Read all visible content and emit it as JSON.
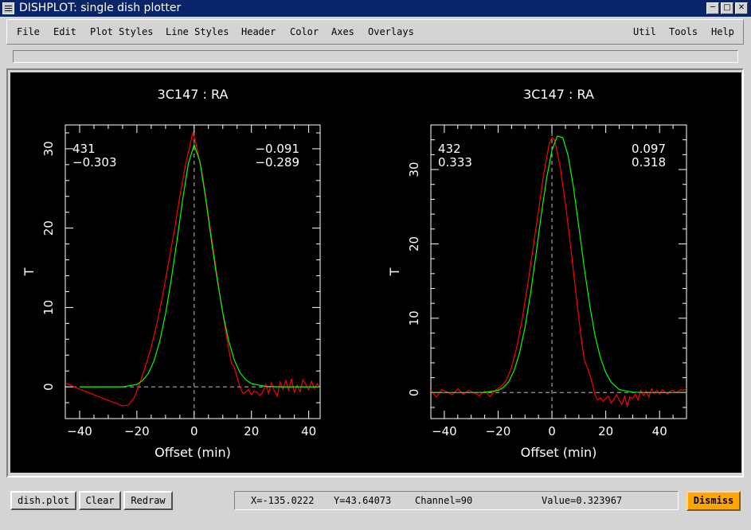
{
  "window": {
    "title": "DISHPLOT: single dish plotter"
  },
  "menu": {
    "left": [
      "File",
      "Edit",
      "Plot Styles",
      "Line Styles",
      "Header",
      "Color",
      "Axes",
      "Overlays"
    ],
    "right": [
      "Util",
      "Tools",
      "Help"
    ]
  },
  "bottom": {
    "buttons": [
      "dish.plot",
      "Clear",
      "Redraw"
    ],
    "status": {
      "x": "X=-135.0222",
      "y": "Y=43.64073",
      "channel": "Channel=90",
      "value": "Value=0.323967"
    },
    "dismiss": "Dismiss"
  },
  "colors": {
    "data": "#ff0000",
    "fit": "#00ff00",
    "axes": "#ffffff",
    "background": "#000000",
    "dismiss": "#ffa500"
  },
  "chart_data": [
    {
      "type": "line",
      "title": "3C147  :  RA",
      "xlabel": "Offset (min)",
      "ylabel": "T",
      "xlim": [
        -45,
        44
      ],
      "ylim": [
        -4,
        33
      ],
      "xticks": [
        -40,
        -20,
        0,
        20,
        40
      ],
      "yticks": [
        0,
        10,
        20,
        30
      ],
      "annotations": {
        "top_left": [
          "431",
          "−0.303"
        ],
        "top_right": [
          "−0.091",
          "−0.289"
        ]
      },
      "series": [
        {
          "color": "#ff0000",
          "x": [
            -45,
            -40,
            -35,
            -30,
            -27,
            -25,
            -23,
            -21,
            -19,
            -17,
            -15,
            -13,
            -11,
            -9,
            -7,
            -5,
            -3,
            -1,
            -0.5,
            0,
            0.5,
            1,
            3,
            5,
            7,
            9,
            11,
            13,
            14,
            15,
            16,
            17,
            18,
            19,
            20,
            21,
            22,
            23,
            24,
            25,
            26,
            27,
            28,
            29,
            30,
            31,
            32,
            33,
            34,
            35,
            36,
            37,
            38,
            39,
            40,
            41,
            42,
            43,
            44
          ],
          "y": [
            0.5,
            -0.3,
            -1.0,
            -1.7,
            -2.1,
            -2.4,
            -2.3,
            -1.4,
            0.4,
            2.6,
            5.0,
            8.0,
            11.5,
            15.5,
            19.5,
            24.0,
            28.0,
            31.2,
            32.0,
            31.5,
            30.8,
            30.0,
            26.5,
            21.5,
            16.5,
            11.5,
            7.0,
            3.0,
            2.5,
            1.2,
            0.0,
            -0.8,
            -0.7,
            -0.3,
            -1.0,
            -0.5,
            -0.7,
            -1.1,
            -0.6,
            0.3,
            -0.8,
            0.5,
            -0.5,
            -1.2,
            0.6,
            -0.3,
            0.8,
            -0.4,
            1.0,
            -0.7,
            0.2,
            -0.6,
            0.9,
            0.3,
            -0.4,
            0.7,
            -0.2,
            0.4,
            -0.1
          ]
        },
        {
          "color": "#00ff00",
          "x": [
            -40,
            -35,
            -30,
            -25,
            -20,
            -18,
            -16,
            -14,
            -12,
            -10,
            -8,
            -6,
            -4,
            -2,
            0,
            2,
            4,
            6,
            8,
            10,
            12,
            14,
            16,
            18,
            20,
            25,
            30,
            35,
            40,
            44
          ],
          "y": [
            0.0,
            0.0,
            0.0,
            0.0,
            0.3,
            0.8,
            1.7,
            3.3,
            5.8,
            9.2,
            13.5,
            18.4,
            23.6,
            28.2,
            30.5,
            28.4,
            23.8,
            18.5,
            13.6,
            9.3,
            5.9,
            3.4,
            1.8,
            0.9,
            0.4,
            0.05,
            0.0,
            0.0,
            0.0,
            0.0
          ]
        }
      ]
    },
    {
      "type": "line",
      "title": "3C147  :  RA",
      "xlabel": "Offset (min)",
      "ylabel": "T",
      "xlim": [
        -45,
        50
      ],
      "ylim": [
        -3.5,
        36
      ],
      "xticks": [
        -40,
        -20,
        0,
        20,
        40
      ],
      "yticks": [
        0,
        10,
        20,
        30
      ],
      "annotations": {
        "top_left": [
          "432",
          "0.333"
        ],
        "top_right": [
          "0.097",
          "0.318"
        ]
      },
      "series": [
        {
          "color": "#ff0000",
          "x": [
            -45,
            -43,
            -41,
            -39,
            -37,
            -35,
            -33,
            -31,
            -29,
            -27,
            -25,
            -23,
            -21,
            -19,
            -17,
            -15,
            -13,
            -11,
            -9,
            -7,
            -5,
            -3,
            -1,
            0,
            1,
            3,
            5,
            7,
            9,
            11,
            12,
            13,
            14,
            15,
            16,
            17,
            18,
            19,
            20,
            21,
            22,
            23,
            24,
            25,
            26,
            27,
            28,
            29,
            30,
            31,
            32,
            33,
            34,
            35,
            36,
            37,
            38,
            39,
            40,
            41,
            42,
            43,
            44,
            45,
            46,
            47,
            48,
            49,
            50
          ],
          "y": [
            0.3,
            -0.6,
            0.4,
            0.1,
            -0.3,
            0.5,
            -0.2,
            0.3,
            0.0,
            -0.4,
            0.2,
            -0.5,
            0.3,
            0.8,
            1.6,
            3.4,
            6.2,
            10.0,
            14.5,
            19.5,
            24.5,
            29.5,
            33.5,
            34.3,
            34.0,
            30.5,
            25.5,
            19.5,
            13.0,
            7.0,
            4.5,
            3.5,
            2.5,
            1.3,
            -0.3,
            -1.0,
            -0.7,
            -1.2,
            -0.8,
            -0.5,
            -1.4,
            -0.9,
            -0.3,
            -1.0,
            -1.6,
            -0.5,
            -1.8,
            -0.6,
            -0.8,
            -0.2,
            -1.0,
            0.3,
            -0.4,
            0.2,
            -0.6,
            0.5,
            -0.1,
            0.3,
            -0.2,
            0.4,
            0.1,
            -0.2,
            0.2,
            0.3,
            0.0,
            0.2,
            0.4,
            0.3,
            0.5
          ]
        },
        {
          "color": "#00ff00",
          "x": [
            -45,
            -40,
            -35,
            -30,
            -25,
            -20,
            -18,
            -16,
            -14,
            -12,
            -10,
            -8,
            -6,
            -4,
            -2,
            0,
            2,
            4,
            6,
            8,
            10,
            12,
            14,
            16,
            18,
            20,
            22,
            25,
            30,
            35,
            40,
            45,
            50
          ],
          "y": [
            0.0,
            0.0,
            0.0,
            0.0,
            0.02,
            0.3,
            0.7,
            1.5,
            3.0,
            5.4,
            8.8,
            13.2,
            18.4,
            23.8,
            28.8,
            32.6,
            34.5,
            34.3,
            31.9,
            27.6,
            22.3,
            16.8,
            11.8,
            7.7,
            4.7,
            2.7,
            1.4,
            0.4,
            0.05,
            0.0,
            0.0,
            0.0,
            0.0
          ]
        }
      ]
    }
  ]
}
